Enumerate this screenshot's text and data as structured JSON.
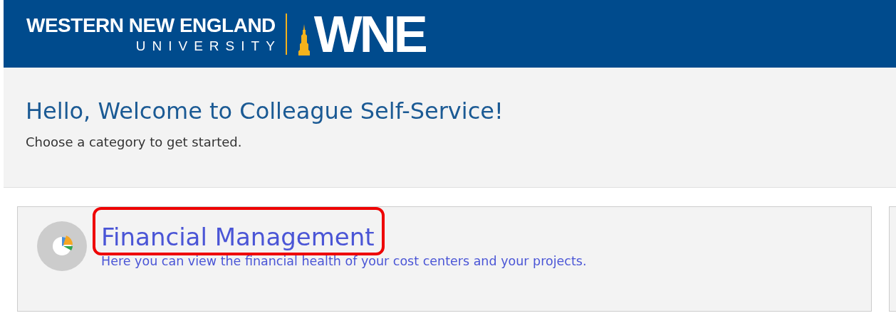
{
  "header": {
    "logo_line_1": "WESTERN NEW ENGLAND",
    "logo_line_2": "UNIVERSITY",
    "logo_mark": "WNE"
  },
  "welcome": {
    "title": "Hello, Welcome to Colleague Self-Service!",
    "subtitle": "Choose a category to get started."
  },
  "categories": [
    {
      "title": "Financial Management",
      "description": "Here you can view the financial health of your cost centers and your projects.",
      "highlighted": true
    }
  ]
}
